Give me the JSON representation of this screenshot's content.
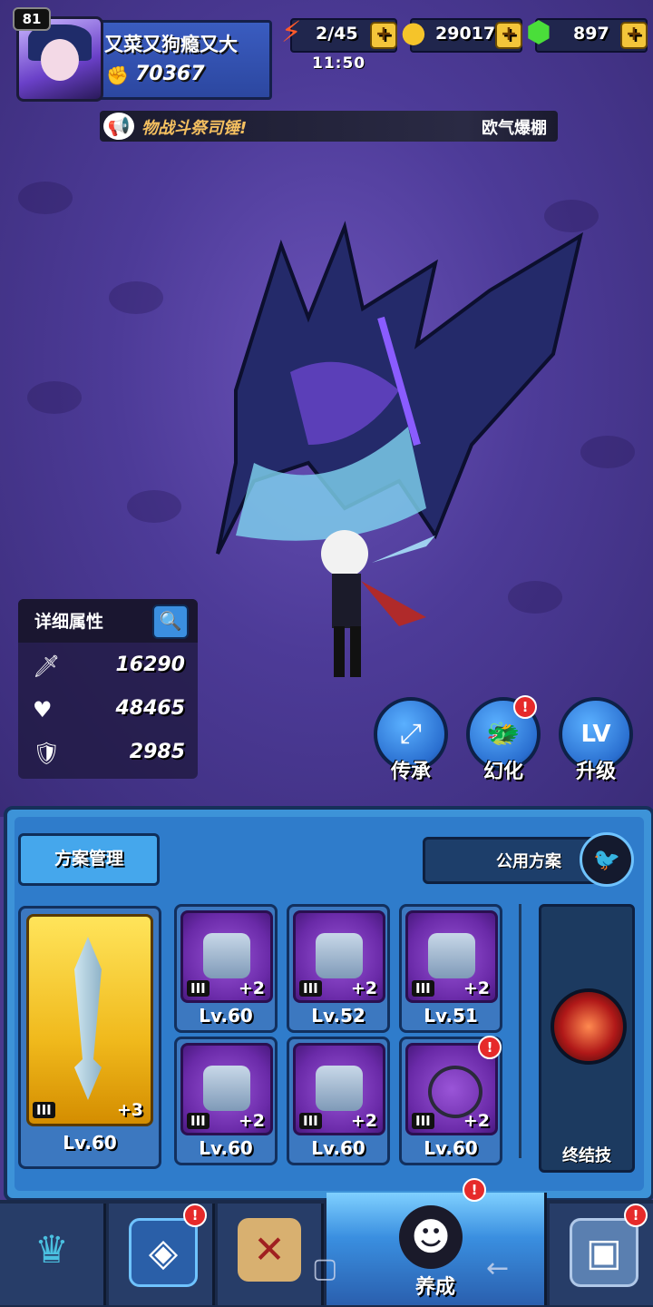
{
  "player": {
    "level": "81",
    "name": "又菜又狗瘾又大",
    "power": "70367"
  },
  "resources": {
    "stamina": "2/45",
    "stamina_timer": "11:50",
    "gold": "29017",
    "gems": "897",
    "plus": "+"
  },
  "notice": {
    "message": "物战斗祭司锤!",
    "sender": "欧气爆棚"
  },
  "stats": {
    "title": "详细属性",
    "attack": "16290",
    "hp": "48465",
    "defense": "2985"
  },
  "actions": [
    {
      "label": "传承"
    },
    {
      "label": "幻化",
      "badge": "!"
    },
    {
      "label": "升级"
    }
  ],
  "panel": {
    "plan_button": "方案管理",
    "public_plan": "公用方案",
    "ultimate_label": "终结技"
  },
  "weapon": {
    "tier": "III",
    "plus": "+3",
    "level": "Lv.60"
  },
  "equipment": [
    {
      "name": "helmet",
      "tier": "III",
      "plus": "+2",
      "level": "Lv.60"
    },
    {
      "name": "chest-armor",
      "tier": "III",
      "plus": "+2",
      "level": "Lv.52"
    },
    {
      "name": "leg-armor",
      "tier": "III",
      "plus": "+2",
      "level": "Lv.51"
    },
    {
      "name": "gauntlet",
      "tier": "III",
      "plus": "+2",
      "level": "Lv.60"
    },
    {
      "name": "boots",
      "tier": "III",
      "plus": "+2",
      "level": "Lv.60"
    },
    {
      "name": "necklace",
      "tier": "III",
      "plus": "+2",
      "level": "Lv.60",
      "badge": "!"
    }
  ],
  "nav": {
    "active_label": "养成",
    "badge": "!"
  },
  "colors": {
    "panel_blue": "#3d93d8",
    "gold_card": "#f0b91c",
    "epic_purple": "#6a2aa8",
    "alert_red": "#e62a2a"
  }
}
